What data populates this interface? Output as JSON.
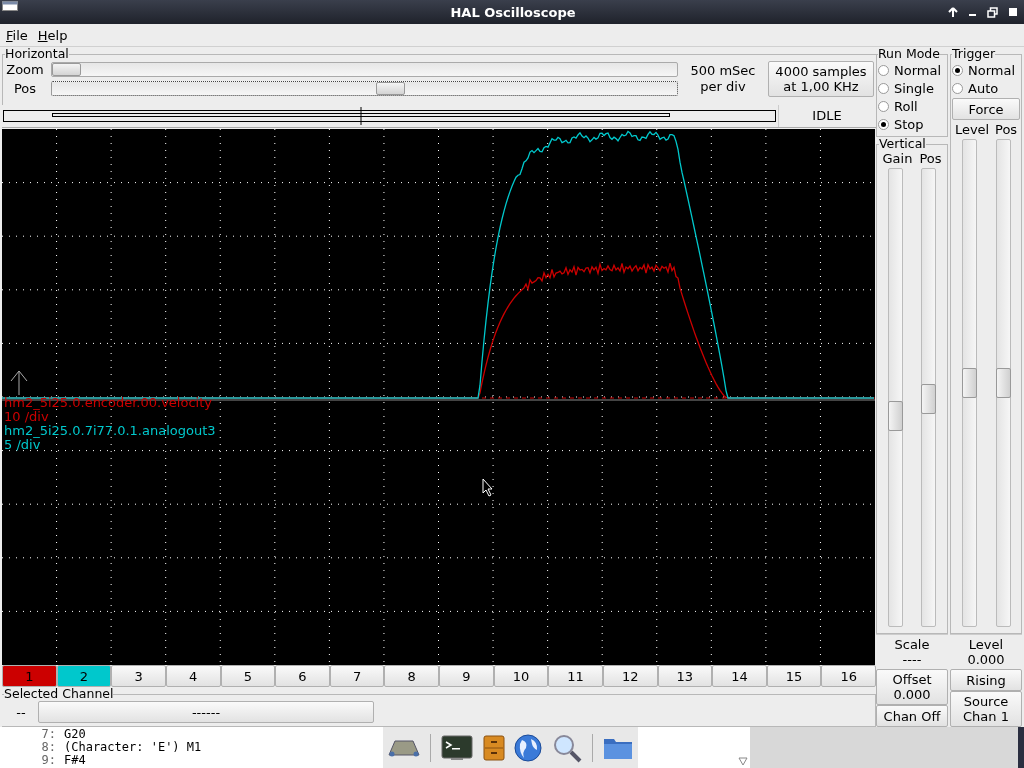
{
  "window": {
    "title": "HAL Oscilloscope"
  },
  "menu": [
    {
      "label": "File"
    },
    {
      "label": "Help"
    }
  ],
  "horizontal": {
    "title": "Horizontal",
    "zoom": {
      "label": "Zoom",
      "level": 0
    },
    "pos": {
      "label": "Pos",
      "level": 0.54
    },
    "rate": "500 mSec\nper div",
    "samples": "4000 samples\nat 1,00 KHz"
  },
  "status": "IDLE",
  "traces": [
    {
      "name": "hm2_5i25.0.encoder.00.velocity",
      "scale": "10 /div",
      "color": "#cc0000"
    },
    {
      "name": "hm2_5i25.0.7i77.0.1.analogout3",
      "scale": "5 /div",
      "color": "#00c8cc"
    }
  ],
  "channels": [
    {
      "label": "1",
      "on": true,
      "color": "#cc0000"
    },
    {
      "label": "2",
      "on": true,
      "color": "#00c8cc"
    },
    {
      "label": "3",
      "on": false
    },
    {
      "label": "4",
      "on": false
    },
    {
      "label": "5",
      "on": false
    },
    {
      "label": "6",
      "on": false
    },
    {
      "label": "7",
      "on": false
    },
    {
      "label": "8",
      "on": false
    },
    {
      "label": "9",
      "on": false
    },
    {
      "label": "10",
      "on": false
    },
    {
      "label": "11",
      "on": false
    },
    {
      "label": "12",
      "on": false
    },
    {
      "label": "13",
      "on": false
    },
    {
      "label": "14",
      "on": false
    },
    {
      "label": "15",
      "on": false
    },
    {
      "label": "16",
      "on": false
    }
  ],
  "selected_channel": {
    "title": "Selected Channel",
    "number": "--",
    "name": "------"
  },
  "run_mode": {
    "title": "Run Mode",
    "options": [
      {
        "label": "Normal",
        "selected": false
      },
      {
        "label": "Single",
        "selected": false
      },
      {
        "label": "Roll",
        "selected": false
      },
      {
        "label": "Stop",
        "selected": true
      }
    ]
  },
  "vertical": {
    "title": "Vertical",
    "gain_label": "Gain",
    "pos_label": "Pos",
    "gain": {
      "level": 0.46
    },
    "pos": {
      "level": 0.5
    },
    "scale_label": "Scale",
    "scale_value": "----",
    "offset": "Offset\n0.000",
    "chan_off": "Chan Off"
  },
  "trigger": {
    "title": "Trigger",
    "options": [
      {
        "label": "Normal",
        "selected": true
      },
      {
        "label": "Auto",
        "selected": false
      }
    ],
    "force": "Force",
    "level_label": "Level",
    "pos_label": "Pos",
    "level_slider": {
      "level": 0.5
    },
    "pos_slider": {
      "level": 0.5
    },
    "level_caption": "Level",
    "level_value": "0.000",
    "edge": "Rising",
    "source": "Source\nChan  1"
  },
  "code_listing": [
    {
      "line": "7:",
      "text": "G20"
    },
    {
      "line": "8:",
      "text": "(Character: 'E') M1"
    },
    {
      "line": "9:",
      "text": "F#4"
    }
  ]
}
